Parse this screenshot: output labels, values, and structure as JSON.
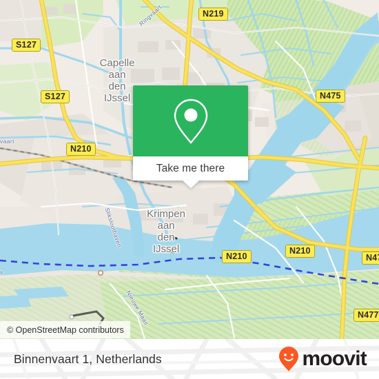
{
  "map": {
    "attribution": "© OpenStreetMap contributors",
    "place_labels": [
      {
        "name": "capelle-aan-den-ijssel",
        "text": "Capelle\naan\nden\nIJssel"
      },
      {
        "name": "krimpen-aan-den-ijssel",
        "text": "Krimpen\naan\nden\nIJssel"
      }
    ],
    "road_shields": [
      {
        "name": "shield-n219",
        "label": "N219"
      },
      {
        "name": "shield-s127-upper",
        "label": "S127"
      },
      {
        "name": "shield-s127-lower",
        "label": "S127"
      },
      {
        "name": "shield-n475",
        "label": "N475"
      },
      {
        "name": "shield-n210-left",
        "label": "N210"
      },
      {
        "name": "shield-n210-center",
        "label": "N210"
      },
      {
        "name": "shield-n210-right",
        "label": "N210"
      },
      {
        "name": "shield-n474",
        "label": "N47"
      },
      {
        "name": "shield-n477",
        "label": "N477"
      }
    ],
    "water_labels": [
      {
        "name": "ringvaart-label",
        "text": "Ringvaart"
      },
      {
        "name": "vaart-label",
        "text": "vaart"
      },
      {
        "name": "sliksloothaven-label",
        "text": "Sliksloothaven"
      },
      {
        "name": "nieuwe-maas-label",
        "text": "Nieuwe Maas"
      },
      {
        "name": "maas-edge-label",
        "text": "s"
      }
    ],
    "colors": {
      "land": "#efe9e3",
      "green": "#cfe8b4",
      "water": "#9fd6ec",
      "road_primary": "#f8d85c",
      "shield_fill": "#fcec52",
      "label_text": "#71706e"
    }
  },
  "callout": {
    "name": "take-me-there-card",
    "button_label": "Take me there",
    "pin_icon": "location-pin-icon",
    "accent_color": "#2ab45e"
  },
  "footer": {
    "address": "Binnenvaart 1, Netherlands",
    "brand_name": "moovit",
    "brand_icon": "moovit-pin-icon",
    "brand_color": "#ff5722",
    "brand_text_color": "#231f20"
  }
}
